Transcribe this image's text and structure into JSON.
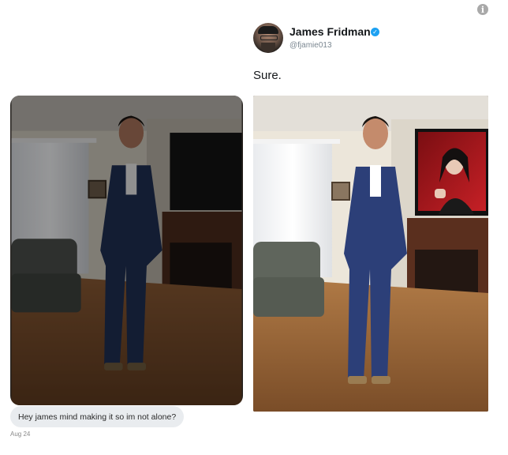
{
  "info_icon": "info-icon",
  "tweet": {
    "author_name": "James Fridman",
    "author_handle": "@fjamie013",
    "verified_icon": "verified-badge-icon",
    "text": "Sure.",
    "accent_color": "#1da1f2"
  },
  "request_photo": {
    "message": "Hey james mind making it so im not alone?",
    "date": "Aug 24"
  },
  "edited_photo": {
    "subject": "man-in-navy-suit",
    "edit": "celebrity-on-tv-screen"
  }
}
